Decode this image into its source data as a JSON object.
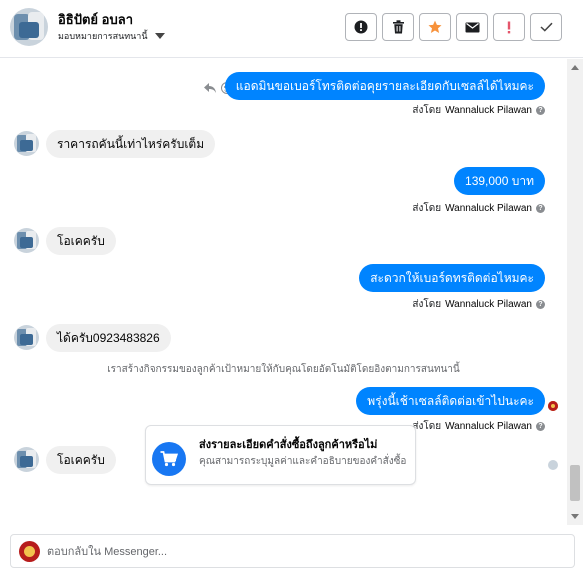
{
  "header": {
    "name": "อิธิปัตย์ อบลา",
    "assign_label": "มอบหมายการสนทนานี้"
  },
  "toolbar": {
    "buttons": [
      {
        "name": "spam-button",
        "icon": "alert-circle-icon"
      },
      {
        "name": "delete-button",
        "icon": "trash-icon"
      },
      {
        "name": "star-button",
        "icon": "star-icon",
        "color": "#f7923b"
      },
      {
        "name": "mark-unread-button",
        "icon": "envelope-icon"
      },
      {
        "name": "follow-up-button",
        "icon": "exclamation-icon",
        "color": "#e4566b"
      },
      {
        "name": "done-button",
        "icon": "check-icon"
      }
    ]
  },
  "messages": {
    "m1": {
      "text": "แอดมินขอเบอร์โทรติดต่อคุยรายละเอียดกับเซลล์ได้ไหมคะ",
      "sender_prefix": "ส่งโดย",
      "sender": "Wannaluck Pilawan"
    },
    "m2": {
      "text": "ราคารถคันนี้เท่าไหร่ครับเต็ม"
    },
    "m3": {
      "text": "139,000 บาท",
      "sender_prefix": "ส่งโดย",
      "sender": "Wannaluck Pilawan"
    },
    "m4": {
      "text": "โอเคครับ"
    },
    "m5": {
      "text": "สะดวกให้เบอร์ดทรติดต่อไหมคะ",
      "sender_prefix": "ส่งโดย",
      "sender": "Wannaluck Pilawan"
    },
    "m6": {
      "text": "ได้ครับ0923483826"
    },
    "system": "เราสร้างกิจกรรมของลูกค้าเป้าหมายให้กับคุณโดยอัตโนมัติโดยอิงตามการสนทนานี้",
    "m7": {
      "text": "พรุ่งนี้เช้าเซลล์ติดต่อเข้าไปนะคะ",
      "sender_prefix": "ส่งโดย",
      "sender": "Wannaluck Pilawan"
    },
    "m8": {
      "text": "โอเคครับ"
    }
  },
  "card": {
    "title": "ส่งรายละเอียดคำสั่งซื้อถึงลูกค้าหรือไม่",
    "subtitle": "คุณสามารถระบุมูลค่าและคำอธิบายของคำสั่งซื้อ",
    "icon": "cart-icon"
  },
  "composer": {
    "placeholder": "ตอบกลับใน Messenger..."
  },
  "colors": {
    "outgoing": "#0084ff",
    "incoming": "#f0f0f0",
    "accent": "#1877f2"
  }
}
